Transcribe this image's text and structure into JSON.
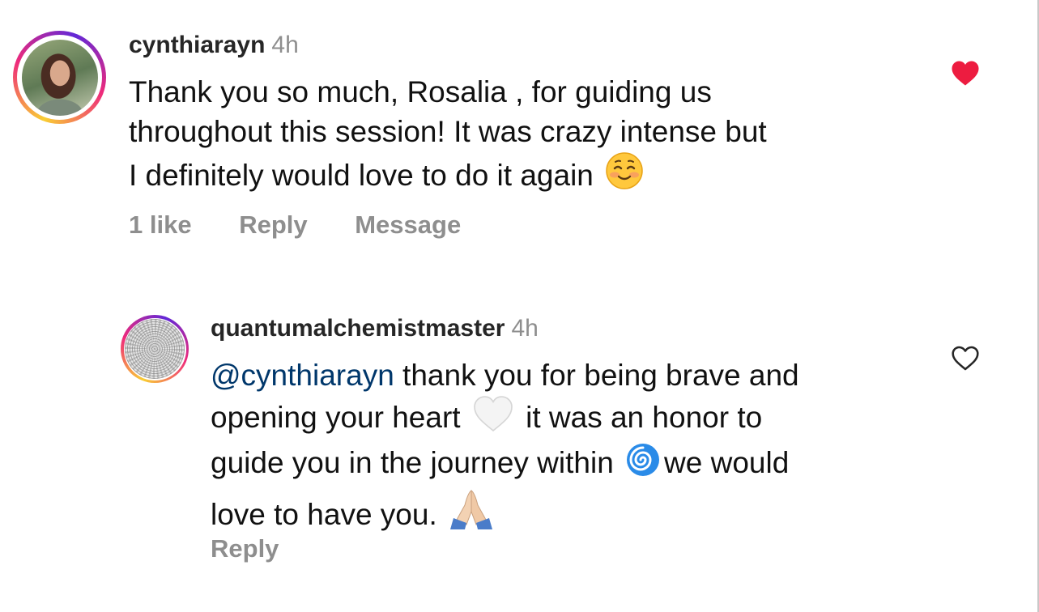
{
  "comment": {
    "username": "cynthiarayn",
    "time": "4h",
    "text_lines": [
      "Thank you so much, Rosalia , for guiding us",
      "throughout this session! It was crazy intense but",
      "I definitely would love to do it again"
    ],
    "emoji": "smiling-face-with-blush",
    "likes_label": "1 like",
    "reply_label": "Reply",
    "message_label": "Message",
    "liked": true,
    "heart_color": "#ed1c40"
  },
  "reply": {
    "username": "quantumalchemistmaster",
    "time": "4h",
    "mention": "@cynthiarayn",
    "text_parts": [
      " thank you for being brave and",
      "opening your heart",
      "it was an honor to",
      "guide you in the journey within",
      "we would",
      "love to have you."
    ],
    "emojis": [
      "white-heart",
      "cyclone",
      "folded-hands"
    ],
    "reply_label": "Reply",
    "liked": false
  },
  "colors": {
    "mention": "#00376b",
    "secondary_text": "#8e8e8e"
  }
}
